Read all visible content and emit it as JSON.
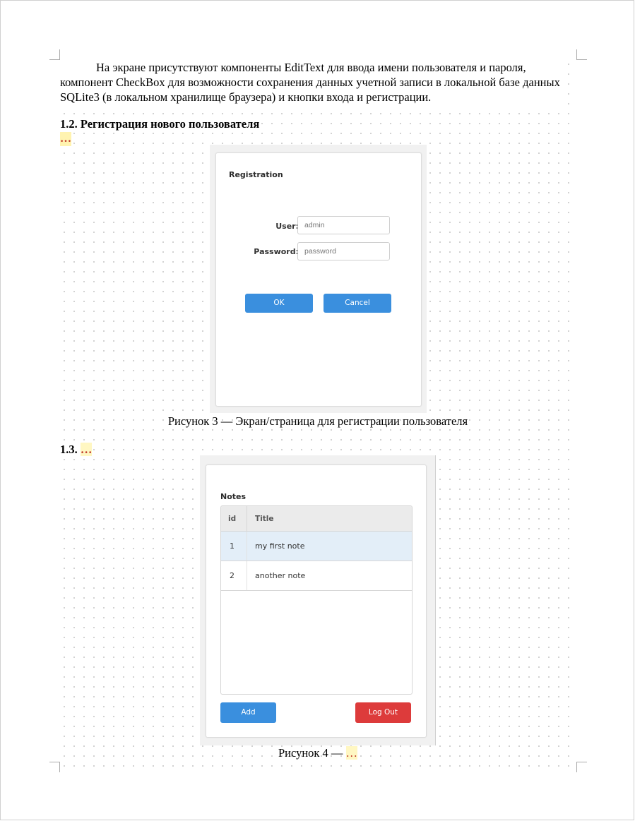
{
  "document": {
    "paragraph": "На экране присутствуют компоненты EditText для ввода имени пользователя и пароля, компонент CheckBox для возможности сохранения данных учетной записи в локальной базе данных SQLite3 (в локальном хранилище браузера) и кнопки входа и регистрации.",
    "heading_1_2": "1.2. Регистрация нового пользователя",
    "placeholder_1_2": "…",
    "caption_3": "Рисунок 3 — Экран/страница для регистрации пользователя",
    "heading_1_3_prefix": "1.3.",
    "heading_1_3_placeholder": "…",
    "caption_4_prefix": "Рисунок 4 —",
    "caption_4_placeholder": "…"
  },
  "registration": {
    "title": "Registration",
    "user_label": "User:",
    "user_placeholder": "admin",
    "password_label": "Password:",
    "password_placeholder": "password",
    "ok_label": "OK",
    "cancel_label": "Cancel"
  },
  "notes": {
    "title": "Notes",
    "columns": [
      "id",
      "Title"
    ],
    "rows": [
      {
        "id": "1",
        "title": "my first note",
        "selected": true
      },
      {
        "id": "2",
        "title": "another note",
        "selected": false
      }
    ],
    "add_label": "Add",
    "logout_label": "Log Out"
  },
  "colors": {
    "primary_button": "#3a8fde",
    "danger_button": "#dd3b3b",
    "selected_row": "#e3eef8",
    "placeholder_highlight": "#fff3b0"
  }
}
